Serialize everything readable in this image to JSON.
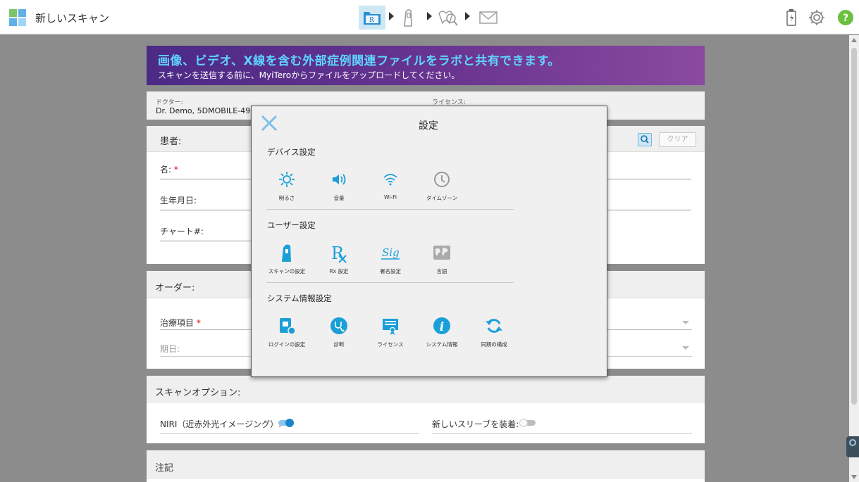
{
  "app": {
    "title": "新しいスキャン"
  },
  "workflow": {
    "steps": [
      "rx-step",
      "scan-step",
      "review-step",
      "send-step"
    ]
  },
  "banner": {
    "title": "画像、ビデオ、X線を含む外部症例関連ファイルをラボと共有できます。",
    "subtitle": "スキャンを送信する前に、MyiTeroからファイルをアップロードしてください。"
  },
  "doctor": {
    "label": "ドクター:",
    "value": "Dr. Demo, 5DMOBILE-49",
    "license_label": "ライセンス:"
  },
  "patient": {
    "title": "患者:",
    "clear": "クリア",
    "name_label": "名:",
    "name_req": "*",
    "dob_label": "生年月日:",
    "chart_label": "チャート#:"
  },
  "order": {
    "title": "オーダー:",
    "treatment_label": "治療項目",
    "treatment_req": "*",
    "due_label": "期日:"
  },
  "scan_options": {
    "title": "スキャンオプション:",
    "niri_label": "NIRI（近赤外光イメージング）:",
    "niri_on": true,
    "sleeve_label": "新しいスリーブを装着:",
    "sleeve_on": false
  },
  "notes": {
    "title": "注記"
  },
  "settings": {
    "title": "設定",
    "device_section": "デバイス設定",
    "device_items": [
      "明るさ",
      "音量",
      "Wi-Fi",
      "タイムゾーン"
    ],
    "user_section": "ユーザー設定",
    "user_items": [
      "スキャンの設定",
      "Rx 設定",
      "署名設定",
      "言語"
    ],
    "system_section": "システム情報設定",
    "system_items": [
      "ログインの設定",
      "診断",
      "ライセンス",
      "システム情報",
      "同期の構成"
    ]
  },
  "colors": {
    "accent": "#1a9fd8",
    "banner_start": "#4b2a86",
    "banner_end": "#8a4aa0",
    "banner_title": "#5fd3ff"
  }
}
